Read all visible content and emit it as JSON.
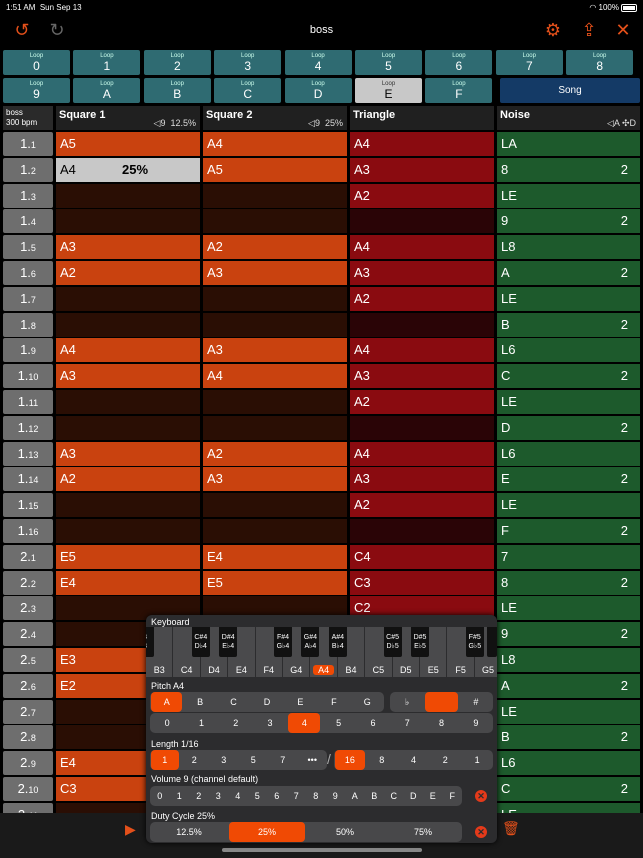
{
  "status": {
    "time": "1:51 AM",
    "date": "Sun Sep 13",
    "battery": "100%"
  },
  "nav": {
    "title": "boss",
    "undo_icon": "undo-icon",
    "redo_icon": "redo-icon",
    "settings_icon": "gear-icon",
    "share_icon": "share-icon",
    "close_icon": "close-icon"
  },
  "loops": {
    "label": "Loop",
    "row1": [
      "0",
      "1",
      "2",
      "3",
      "4",
      "5",
      "6",
      "7",
      "8"
    ],
    "row2": [
      "9",
      "A",
      "B",
      "C",
      "D",
      "E",
      "F"
    ],
    "selected": "E",
    "song_label": "Song"
  },
  "song": {
    "name": "boss",
    "tempo": "300 bpm"
  },
  "channels": [
    {
      "name": "Square 1",
      "volume": "9",
      "duty": "12.5%"
    },
    {
      "name": "Square 2",
      "volume": "9",
      "duty": "25%"
    },
    {
      "name": "Triangle"
    },
    {
      "name": "Noise",
      "volume": "A",
      "extra": "D"
    }
  ],
  "rows": [
    {
      "num": "1",
      "sub": "1",
      "sq1": "A5",
      "sq2": "A4",
      "tri": "A4",
      "noise": "LA",
      "noise_len": ""
    },
    {
      "num": "1",
      "sub": "2",
      "sq1": "A4",
      "sq1_extra": "25%",
      "sq2": "A5",
      "tri": "A3",
      "noise": "8",
      "noise_len": "2"
    },
    {
      "num": "1",
      "sub": "3",
      "sq1": "",
      "sq2": "",
      "tri": "A2",
      "noise": "LE",
      "noise_len": ""
    },
    {
      "num": "1",
      "sub": "4",
      "sq1": "",
      "sq2": "",
      "tri": "",
      "noise": "9",
      "noise_len": "2"
    },
    {
      "num": "1",
      "sub": "5",
      "sq1": "A3",
      "sq2": "A2",
      "tri": "A4",
      "noise": "L8",
      "noise_len": ""
    },
    {
      "num": "1",
      "sub": "6",
      "sq1": "A2",
      "sq2": "A3",
      "tri": "A3",
      "noise": "A",
      "noise_len": "2"
    },
    {
      "num": "1",
      "sub": "7",
      "sq1": "",
      "sq2": "",
      "tri": "A2",
      "noise": "LE",
      "noise_len": ""
    },
    {
      "num": "1",
      "sub": "8",
      "sq1": "",
      "sq2": "",
      "tri": "",
      "noise": "B",
      "noise_len": "2"
    },
    {
      "num": "1",
      "sub": "9",
      "sq1": "A4",
      "sq2": "A3",
      "tri": "A4",
      "noise": "L6",
      "noise_len": ""
    },
    {
      "num": "1",
      "sub": "10",
      "sq1": "A3",
      "sq2": "A4",
      "tri": "A3",
      "noise": "C",
      "noise_len": "2"
    },
    {
      "num": "1",
      "sub": "11",
      "sq1": "",
      "sq2": "",
      "tri": "A2",
      "noise": "LE",
      "noise_len": ""
    },
    {
      "num": "1",
      "sub": "12",
      "sq1": "",
      "sq2": "",
      "tri": "",
      "noise": "D",
      "noise_len": "2"
    },
    {
      "num": "1",
      "sub": "13",
      "sq1": "A3",
      "sq2": "A2",
      "tri": "A4",
      "noise": "L6",
      "noise_len": ""
    },
    {
      "num": "1",
      "sub": "14",
      "sq1": "A2",
      "sq2": "A3",
      "tri": "A3",
      "noise": "E",
      "noise_len": "2"
    },
    {
      "num": "1",
      "sub": "15",
      "sq1": "",
      "sq2": "",
      "tri": "A2",
      "noise": "LE",
      "noise_len": ""
    },
    {
      "num": "1",
      "sub": "16",
      "sq1": "",
      "sq2": "",
      "tri": "",
      "noise": "F",
      "noise_len": "2"
    },
    {
      "num": "2",
      "sub": "1",
      "sq1": "E5",
      "sq2": "E4",
      "tri": "C4",
      "noise": "7",
      "noise_len": ""
    },
    {
      "num": "2",
      "sub": "2",
      "sq1": "E4",
      "sq2": "E5",
      "tri": "C3",
      "noise": "8",
      "noise_len": "2"
    },
    {
      "num": "2",
      "sub": "3",
      "sq1": "",
      "sq2": "",
      "tri": "C2",
      "noise": "LE",
      "noise_len": ""
    },
    {
      "num": "2",
      "sub": "4",
      "sq1": "",
      "sq2": "",
      "tri": "",
      "noise": "9",
      "noise_len": "2"
    },
    {
      "num": "2",
      "sub": "5",
      "sq1": "E3",
      "sq2": "",
      "tri": "",
      "noise": "L8",
      "noise_len": ""
    },
    {
      "num": "2",
      "sub": "6",
      "sq1": "E2",
      "sq2": "",
      "tri": "",
      "noise": "A",
      "noise_len": "2"
    },
    {
      "num": "2",
      "sub": "7",
      "sq1": "",
      "sq2": "",
      "tri": "",
      "noise": "LE",
      "noise_len": ""
    },
    {
      "num": "2",
      "sub": "8",
      "sq1": "",
      "sq2": "",
      "tri": "",
      "noise": "B",
      "noise_len": "2"
    },
    {
      "num": "2",
      "sub": "9",
      "sq1": "E4",
      "sq2": "",
      "tri": "",
      "noise": "L6",
      "noise_len": ""
    },
    {
      "num": "2",
      "sub": "10",
      "sq1": "C3",
      "sq2": "",
      "tri": "",
      "noise": "C",
      "noise_len": "2"
    },
    {
      "num": "2",
      "sub": "11",
      "sq1": "",
      "sq2": "",
      "tri": "",
      "noise": "LE",
      "noise_len": ""
    }
  ],
  "keyboard": {
    "title": "Keyboard",
    "white_keys": [
      "B3",
      "C4",
      "D4",
      "E4",
      "F4",
      "G4",
      "A4",
      "B4",
      "C5",
      "D5",
      "E5",
      "F5",
      "G5"
    ],
    "black_keys": [
      [
        "3",
        "3"
      ],
      [
        "C#4",
        "D♭4"
      ],
      [
        "D#4",
        "E♭4"
      ],
      [
        "F#4",
        "G♭4"
      ],
      [
        "G#4",
        "A♭4"
      ],
      [
        "A#4",
        "B♭4"
      ],
      [
        "C#5",
        "D♭5"
      ],
      [
        "D#5",
        "E♭5"
      ],
      [
        "F#5",
        "G♭5"
      ]
    ],
    "selected": "A4"
  },
  "pitch": {
    "title": "Pitch A4",
    "notes": [
      "A",
      "B",
      "C",
      "D",
      "E",
      "F",
      "G"
    ],
    "accidentals": [
      "♭",
      "",
      "#"
    ],
    "octaves": [
      "0",
      "1",
      "2",
      "3",
      "4",
      "5",
      "6",
      "7",
      "8",
      "9"
    ],
    "selected_note": "A",
    "selected_octave": "4"
  },
  "length": {
    "title": "Length 1/16",
    "numerators": [
      "1",
      "2",
      "3",
      "5",
      "7",
      "•••"
    ],
    "separator": "/",
    "denominators": [
      "16",
      "8",
      "4",
      "2",
      "1"
    ]
  },
  "volume": {
    "title": "Volume 9 (channel default)",
    "values": [
      "0",
      "1",
      "2",
      "3",
      "4",
      "5",
      "6",
      "7",
      "8",
      "9",
      "A",
      "B",
      "C",
      "D",
      "E",
      "F"
    ]
  },
  "duty": {
    "title": "Duty Cycle 25%",
    "values": [
      "12.5%",
      "25%",
      "50%",
      "75%"
    ],
    "selected": "25%"
  },
  "colors": {
    "accent": "#f04a04",
    "square": "#c9420f",
    "triangle": "#8a0b10",
    "noise": "#1d5a2c",
    "loop": "#2f6b72",
    "song": "#143a66"
  }
}
